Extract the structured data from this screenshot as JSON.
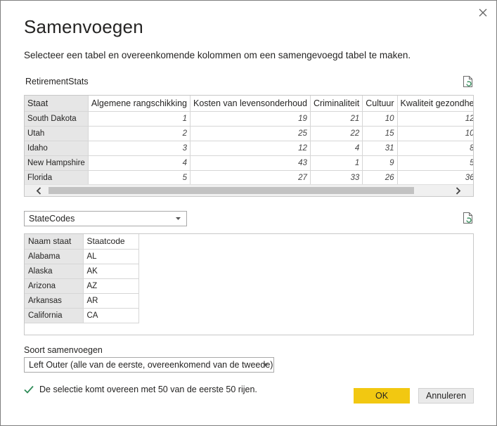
{
  "dialog": {
    "title": "Samenvoegen",
    "subtitle": "Selecteer een tabel en overeenkomende kolommen om een samengevoegd tabel te maken."
  },
  "table1": {
    "name": "RetirementStats",
    "columns": [
      "Staat",
      "Algemene rangschikking",
      "Kosten van levensonderhoud",
      "Criminaliteit",
      "Cultuur",
      "Kwaliteit gezondhe"
    ],
    "rows": [
      [
        "South Dakota",
        "1",
        "19",
        "21",
        "10",
        "12"
      ],
      [
        "Utah",
        "2",
        "25",
        "22",
        "15",
        "10"
      ],
      [
        "Idaho",
        "3",
        "12",
        "4",
        "31",
        "8"
      ],
      [
        "New Hampshire",
        "4",
        "43",
        "1",
        "9",
        "5"
      ],
      [
        "Florida",
        "5",
        "27",
        "33",
        "26",
        "36"
      ]
    ]
  },
  "table2": {
    "selected": "StateCodes",
    "columns": [
      "Naam staat",
      "Staatcode"
    ],
    "rows": [
      [
        "Alabama",
        "AL"
      ],
      [
        "Alaska",
        "AK"
      ],
      [
        "Arizona",
        "AZ"
      ],
      [
        "Arkansas",
        "AR"
      ],
      [
        "California",
        "CA"
      ]
    ]
  },
  "join": {
    "label": "Soort samenvoegen",
    "selected": "Left Outer (alle van de eerste, overeenkomend van de tweede)"
  },
  "status": {
    "text": "De selectie komt overeen met 50 van de eerste 50 rijen."
  },
  "buttons": {
    "ok": "OK",
    "cancel": "Annuleren"
  },
  "colors": {
    "accent": "#f2c811",
    "check": "#2e8b57",
    "refresh_icon": "#2e8b57"
  },
  "icons": {
    "close": "close-icon",
    "refresh": "refresh-file-icon",
    "check": "check-icon",
    "caret": "chevron-down-icon",
    "scroll_left": "chevron-left-icon",
    "scroll_right": "chevron-right-icon"
  }
}
